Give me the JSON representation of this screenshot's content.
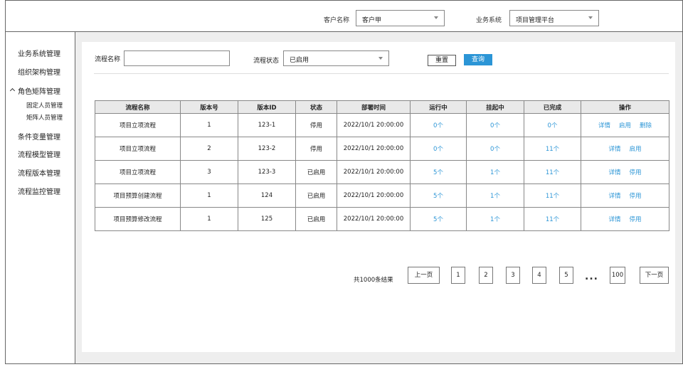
{
  "header": {
    "customer_label": "客户名称",
    "customer_value": "客户甲",
    "system_label": "业务系统",
    "system_value": "项目管理平台"
  },
  "sidebar": {
    "items": [
      {
        "label": "业务系统管理"
      },
      {
        "label": "组织架构管理"
      },
      {
        "label": "角色矩阵管理",
        "expanded": true,
        "children": [
          {
            "label": "固定人员管理"
          },
          {
            "label": "矩阵人员管理"
          }
        ]
      },
      {
        "label": "条件变量管理"
      },
      {
        "label": "流程模型管理"
      },
      {
        "label": "流程版本管理"
      },
      {
        "label": "流程监控管理"
      }
    ]
  },
  "filters": {
    "name_label": "流程名称",
    "name_value": "",
    "status_label": "流程状态",
    "status_value": "已启用",
    "reset_label": "重置",
    "query_label": "查询"
  },
  "table": {
    "columns": [
      "流程名称",
      "版本号",
      "版本ID",
      "状态",
      "部署时间",
      "运行中",
      "挂起中",
      "已完成",
      "操作"
    ],
    "rows": [
      {
        "name": "项目立项流程",
        "version": "1",
        "version_id": "123-1",
        "status": "停用",
        "deploy_time": "2022/10/1  20:00:00",
        "running": "0个",
        "suspended": "0个",
        "completed": "0个",
        "actions": [
          "详情",
          "启用",
          "删除"
        ]
      },
      {
        "name": "项目立项流程",
        "version": "2",
        "version_id": "123-2",
        "status": "停用",
        "deploy_time": "2022/10/1  20:00:00",
        "running": "0个",
        "suspended": "0个",
        "completed": "11个",
        "actions": [
          "详情",
          "启用"
        ]
      },
      {
        "name": "项目立项流程",
        "version": "3",
        "version_id": "123-3",
        "status": "已启用",
        "deploy_time": "2022/10/1  20:00:00",
        "running": "5个",
        "suspended": "1个",
        "completed": "11个",
        "actions": [
          "详情",
          "停用"
        ]
      },
      {
        "name": "项目预算创建流程",
        "version": "1",
        "version_id": "124",
        "status": "已启用",
        "deploy_time": "2022/10/1  20:00:00",
        "running": "5个",
        "suspended": "1个",
        "completed": "11个",
        "actions": [
          "详情",
          "停用"
        ]
      },
      {
        "name": "项目预算修改流程",
        "version": "1",
        "version_id": "125",
        "status": "已启用",
        "deploy_time": "2022/10/1  20:00:00",
        "running": "5个",
        "suspended": "1个",
        "completed": "11个",
        "actions": [
          "详情",
          "停用"
        ]
      }
    ]
  },
  "pagination": {
    "total": "共1000条结果",
    "prev": "上一页",
    "pages": [
      "1",
      "2",
      "3",
      "4",
      "5"
    ],
    "ellipsis": "...",
    "last": "100",
    "next": "下一页"
  },
  "colors": {
    "accent": "#2b95d6",
    "content_bg": "#eeeeee",
    "header_bg": "#e9e9e9"
  }
}
